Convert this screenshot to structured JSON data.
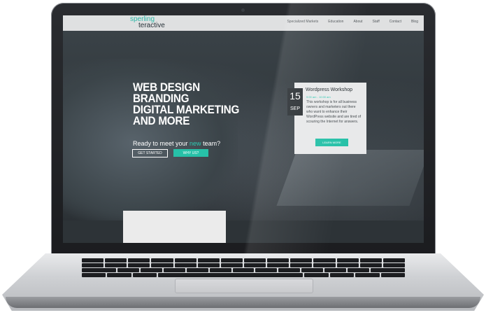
{
  "site": {
    "logo_line1": "sperling",
    "logo_line2": "teractive"
  },
  "nav": {
    "items": [
      "Specialized Markets",
      "Education",
      "About",
      "Staff",
      "Contact",
      "Blog"
    ]
  },
  "hero": {
    "headline": [
      "WEB DESIGN",
      "BRANDING",
      "DIGITAL MARKETING",
      "AND MORE"
    ],
    "tagline_before": "Ready to meet your ",
    "tagline_highlight": "new",
    "tagline_after": " team?",
    "primary_button": "GET STARTED",
    "secondary_button": "WHY US?"
  },
  "event": {
    "day": "15",
    "month": "SEP",
    "title": "Wordpress Workshop",
    "time": "9:00 am - 10:00 am",
    "description": "This workshop is for all business owners and marketers out there who want to enhance their WordPress website and are tired of scouring the Internet for answers.",
    "button": "LEARN MORE"
  },
  "colors": {
    "accent": "#27c1a8",
    "topbar": "#dfe0e1",
    "hero_dark": "#2f363b"
  }
}
